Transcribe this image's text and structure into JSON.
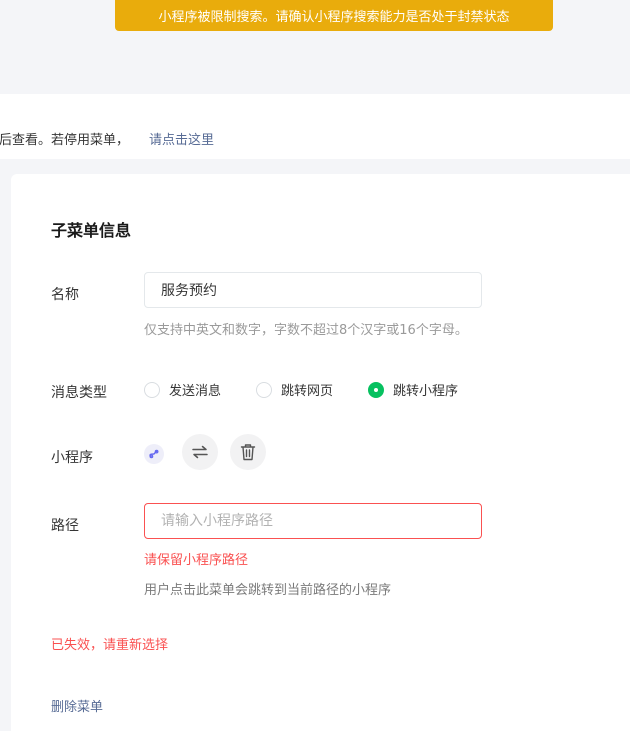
{
  "banner": {
    "warning": "小程序被限制搜索。请确认小程序搜索能力是否处于封禁状态",
    "color": "#e9ac0c"
  },
  "notice": {
    "text": "稍后查看。若停用菜单，",
    "link": "请点击这里"
  },
  "form": {
    "title": "子菜单信息",
    "name": {
      "label": "名称",
      "value": "服务预约",
      "hint": "仅支持中英文和数字，字数不超过8个汉字或16个字母。"
    },
    "message_type": {
      "label": "消息类型",
      "options": [
        "发送消息",
        "跳转网页",
        "跳转小程序"
      ],
      "selected": "跳转小程序",
      "accent": "#07c160"
    },
    "miniprogram": {
      "label": "小程序",
      "icons": [
        "miniprogram-icon",
        "swap-icon",
        "trash-icon"
      ]
    },
    "path": {
      "label": "路径",
      "placeholder": "请输入小程序路径",
      "value": "",
      "error": "请保留小程序路径",
      "hint": "用户点击此菜单会跳转到当前路径的小程序"
    },
    "invalid_notice": "已失效，请重新选择",
    "delete_label": "删除菜单",
    "error_color": "#fa5151"
  }
}
